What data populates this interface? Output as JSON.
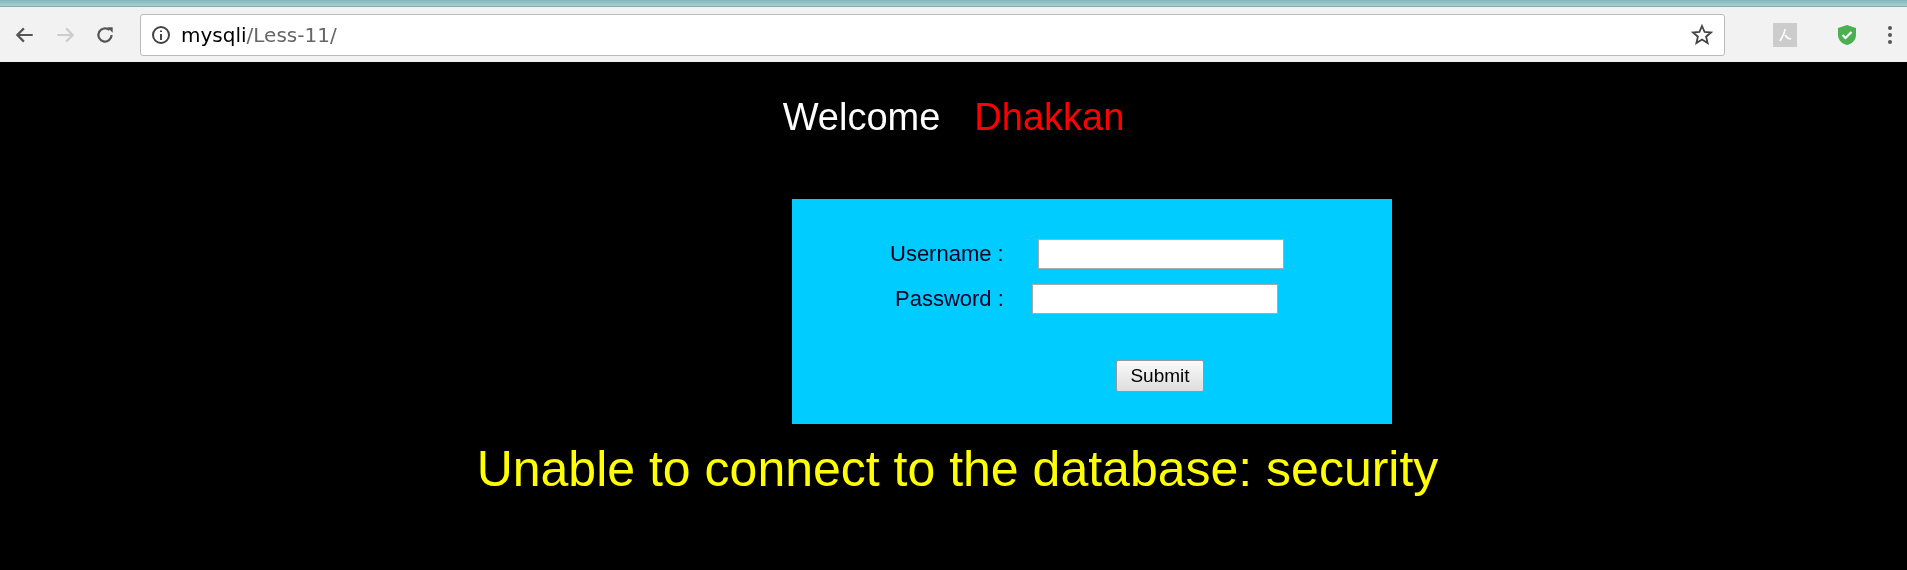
{
  "address_bar": {
    "host": "mysqli",
    "path": "/Less-11/"
  },
  "welcome": {
    "greeting": "Welcome",
    "name": "Dhakkan"
  },
  "login_form": {
    "fields": [
      {
        "label": "Username :"
      },
      {
        "label": "Password :"
      }
    ],
    "submit": "Submit"
  },
  "error_message": "Unable to connect to the database: security"
}
